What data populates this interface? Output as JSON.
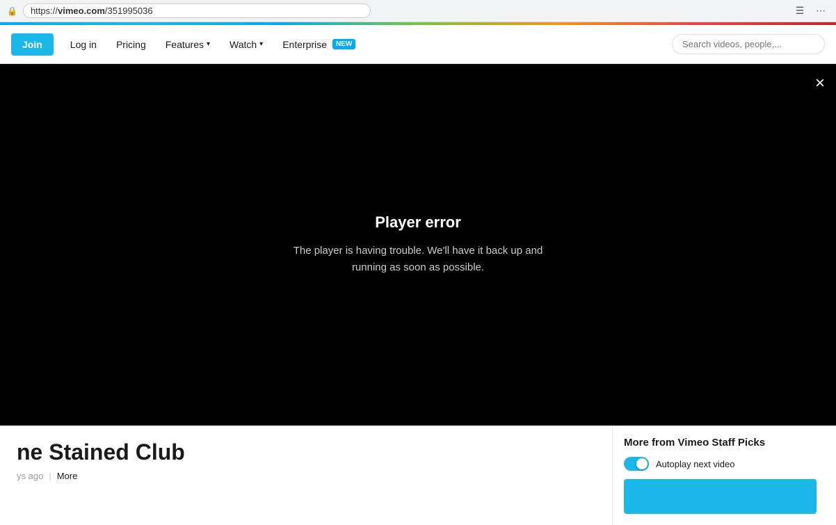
{
  "browser": {
    "url_prefix": "https://",
    "url_domain": "vimeo.com",
    "url_path": "/351995036"
  },
  "nav": {
    "join_label": "Join",
    "login_label": "Log in",
    "pricing_label": "Pricing",
    "features_label": "Features",
    "watch_label": "Watch",
    "enterprise_label": "Enterprise",
    "enterprise_badge": "NEW",
    "search_placeholder": "Search videos, people,..."
  },
  "player": {
    "error_title": "Player error",
    "error_message": "The player is having trouble. We'll have it back up and running as soon as possible.",
    "close_label": "×"
  },
  "video_info": {
    "title": "ne Stained Club",
    "time_ago": "ys ago",
    "more_label": "More"
  },
  "sidebar": {
    "more_from_label": "More from Vimeo Staff Picks",
    "autoplay_label": "Autoplay next video"
  }
}
